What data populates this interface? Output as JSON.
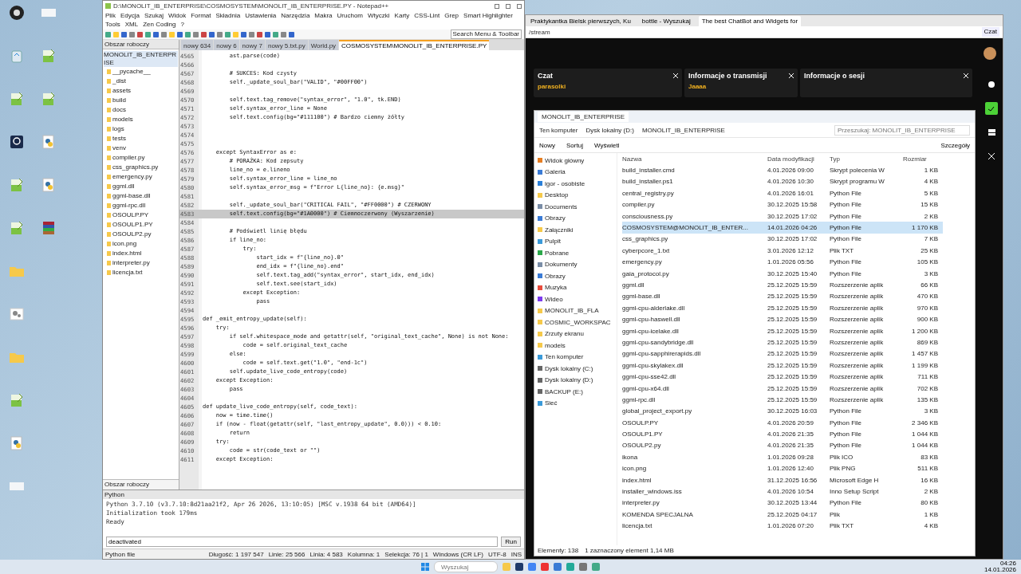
{
  "desktop": {
    "columns": [
      [
        {
          "kind": "obs"
        },
        {
          "kind": "recycle"
        },
        {
          "kind": "notepad"
        },
        {
          "kind": "camera"
        },
        {
          "kind": "notepad"
        },
        {
          "kind": "notepad"
        },
        {
          "kind": "folder"
        },
        {
          "kind": "settings"
        },
        {
          "kind": "folder"
        },
        {
          "kind": "notepad"
        },
        {
          "kind": "python"
        },
        {
          "kind": "blank"
        }
      ],
      [
        {
          "kind": "blank"
        },
        {
          "kind": "notepad"
        },
        {
          "kind": "notepad"
        },
        {
          "kind": "python"
        },
        {
          "kind": "python"
        },
        {
          "kind": "archive"
        }
      ]
    ]
  },
  "editor": {
    "title": "D:\\MONOLIT_IB_ENTERPRISE\\COSMOSYSTEM\\MONOLIT_IB_ENTERPRISE.PY - Notepad++",
    "menu": [
      "Plik",
      "Edycja",
      "Szukaj",
      "Widok",
      "Format",
      "Składnia",
      "Ustawienia",
      "Narzędzia",
      "Makra",
      "Uruchom",
      "Wtyczki",
      "Karty",
      "CSS-Lint",
      "Grep",
      "Smart Highlighter",
      "Tools",
      "XML",
      "Zen Coding",
      "?"
    ],
    "search_menu": "Search Menu & Toolbar",
    "tabs": [
      {
        "label": "nowy 634",
        "selected": false
      },
      {
        "label": "nowy 6",
        "selected": false
      },
      {
        "label": "nowy 7",
        "selected": false
      },
      {
        "label": "nowy 5.txt.py",
        "selected": false
      },
      {
        "label": "World.py",
        "selected": false
      },
      {
        "label": "COSMOSYSTEM\\MONOLIT_IB_ENTERPRISE.PY",
        "selected": true
      }
    ],
    "workspace": {
      "title": "Obszar roboczy",
      "root": "MONOLIT_IB_ENTERPRISE",
      "items": [
        "__pycache__",
        "_dist",
        "assets",
        "build",
        "docs",
        "models",
        "logs",
        "tests",
        "venv",
        "compiler.py",
        "css_graphics.py",
        "emergency.py",
        "ggml.dll",
        "ggml-base.dll",
        "ggml-rpc.dll",
        "OSOULP.PY",
        "OSOULP1.PY",
        "OSOULP2.py",
        "icon.png",
        "index.html",
        "interpreter.py",
        "licencja.txt"
      ],
      "footer": "Obszar roboczy"
    },
    "lines": [
      {
        "number": "4565",
        "code": "        ast.parse(code)"
      },
      {
        "number": "4566"
      },
      {
        "number": "4567",
        "code": "        # SUKCES: Kod czysty"
      },
      {
        "number": "4568",
        "code": "        self._update_soul_bar(\"VALID\", \"#00FF00\")"
      },
      {
        "number": "4569"
      },
      {
        "number": "4570",
        "code": "        self.text.tag_remove(\"syntax_error\", \"1.0\", tk.END)"
      },
      {
        "number": "4571",
        "code": "        self.syntax_error_line = None"
      },
      {
        "number": "4572",
        "code": "        self.text.config(bg=\"#111100\") # Bardzo ciemny żółty"
      },
      {
        "number": "4573"
      },
      {
        "number": "4574"
      },
      {
        "number": "4575"
      },
      {
        "number": "4576",
        "code": "    except SyntaxError as e:"
      },
      {
        "number": "4577",
        "code": "        # PORAŻKA: Kod zepsuty"
      },
      {
        "number": "4578",
        "code": "        line_no = e.lineno"
      },
      {
        "number": "4579",
        "code": "        self.syntax_error_line = line_no"
      },
      {
        "number": "4580",
        "code": "        self.syntax_error_msg = f\"Error L{line_no}: {e.msg}\""
      },
      {
        "number": "4581"
      },
      {
        "number": "4582",
        "code": "        self._update_soul_bar(\"CRITICAL FAIL\", \"#FF0000\") # CZERWONY"
      },
      {
        "number": "4583",
        "code": "        self.text.config(bg=\"#1A0000\") # Ciemnoczerwony (Wyszarzenie)",
        "current": true
      },
      {
        "number": "4584"
      },
      {
        "number": "4585",
        "code": "        # Podświetl linię błędu"
      },
      {
        "number": "4586",
        "code": "        if line_no:"
      },
      {
        "number": "4587",
        "code": "            try:"
      },
      {
        "number": "4588",
        "code": "                start_idx = f\"{line_no}.0\""
      },
      {
        "number": "4589",
        "code": "                end_idx = f\"{line_no}.end\""
      },
      {
        "number": "4590",
        "code": "                self.text.tag_add(\"syntax_error\", start_idx, end_idx)"
      },
      {
        "number": "4591",
        "code": "                self.text.see(start_idx)"
      },
      {
        "number": "4592",
        "code": "            except Exception:"
      },
      {
        "number": "4593",
        "code": "                pass"
      },
      {
        "number": "4594"
      },
      {
        "number": "4595",
        "code": "def _emit_entropy_update(self):"
      },
      {
        "number": "4596",
        "code": "    try:"
      },
      {
        "number": "4597",
        "code": "        if self.whitespace_mode and getattr(self, \"original_text_cache\", None) is not None:"
      },
      {
        "number": "4598",
        "code": "            code = self.original_text_cache"
      },
      {
        "number": "4599",
        "code": "        else:"
      },
      {
        "number": "4600",
        "code": "            code = self.text.get(\"1.0\", \"end-1c\")"
      },
      {
        "number": "4601",
        "code": "        self.update_live_code_entropy(code)"
      },
      {
        "number": "4602",
        "code": "    except Exception:"
      },
      {
        "number": "4603",
        "code": "        pass"
      },
      {
        "number": "4604"
      },
      {
        "number": "4605",
        "code": "def update_live_code_entropy(self, code_text):"
      },
      {
        "number": "4606",
        "code": "    now = time.time()"
      },
      {
        "number": "4607",
        "code": "    if (now - float(getattr(self, \"last_entropy_update\", 0.0))) < 0.10:"
      },
      {
        "number": "4608",
        "code": "        return"
      },
      {
        "number": "4609",
        "code": "    try:"
      },
      {
        "number": "4610",
        "code": "        code = str(code_text or \"\")"
      },
      {
        "number": "4611",
        "code": "    except Exception:"
      }
    ],
    "console": {
      "title": "Python",
      "lines": [
        "Python 3.7.10 (v3.7.10:8d21aa21f2, Apr 26 2026, 13:10:05) [MSC v.1938 64 bit (AMD64)]",
        "Initialization took 179ms",
        "Ready"
      ],
      "input": "deactivated",
      "run": "Run"
    },
    "status": [
      "Python file",
      "Długość: 1 197 547",
      "Linie: 25 566",
      "Linia: 4 583",
      "Kolumna: 1",
      "Selekcja: 76 | 1",
      "Windows (CR LF)",
      "UTF-8",
      "INS"
    ]
  },
  "browser": {
    "tabs": [
      {
        "label": "Praktykantka Bielsk pierwszych, Ku",
        "selected": false
      },
      {
        "label": "bottle - Wyszukaj",
        "selected": false
      },
      {
        "label": "The best ChatBot and Widgets for",
        "selected": true
      }
    ],
    "address": "/stream",
    "copilot": "Czat",
    "panels": [
      {
        "kind": "chat",
        "title": "Czat",
        "text": "parasolki"
      },
      {
        "kind": "info",
        "title": "Informacje o transmisji",
        "text": "Jaaaa"
      },
      {
        "kind": "session",
        "title": "Informacje o sesji"
      }
    ]
  },
  "explorer": {
    "tab": "MONOLIT_IB_ENTERPRISE",
    "breadcrumb": [
      "Ten komputer",
      "Dysk lokalny (D:)",
      "MONOLIT_IB_ENTERPRISE"
    ],
    "search": {
      "placeholder": "Przeszukaj: MONOLIT_IB_ENTERPRISE"
    },
    "toolbar": {
      "new": "Nowy",
      "sort": "Sortuj",
      "view": "Wyświetl",
      "details": "Szczegóły"
    },
    "nav": [
      {
        "label": "Widok główny",
        "kind": "home"
      },
      {
        "label": "Galeria",
        "kind": "gallery"
      },
      {
        "label": "igor - osobiste",
        "kind": "cloud"
      },
      {
        "label": "Desktop",
        "kind": "folder"
      },
      {
        "label": "Documents",
        "kind": "doc"
      },
      {
        "label": "Obrazy",
        "kind": "pictures"
      },
      {
        "label": "Załączniki",
        "kind": "folder"
      },
      {
        "label": "Pulpit",
        "kind": "desktop"
      },
      {
        "label": "Pobrane",
        "kind": "download"
      },
      {
        "label": "Dokumenty",
        "kind": "doc"
      },
      {
        "label": "Obrazy",
        "kind": "pictures"
      },
      {
        "label": "Muzyka",
        "kind": "music"
      },
      {
        "label": "Wideo",
        "kind": "video"
      },
      {
        "label": "MONOLIT_IB_FLA",
        "kind": "folder"
      },
      {
        "label": "COSMIC_WORKSPAC",
        "kind": "folder"
      },
      {
        "label": "Zrzuty ekranu",
        "kind": "folder"
      },
      {
        "label": "models",
        "kind": "folder"
      },
      {
        "label": "Ten komputer",
        "kind": "pc"
      },
      {
        "label": "Dysk lokalny (C:)",
        "kind": "drive"
      },
      {
        "label": "Dysk lokalny (D:)",
        "kind": "drive"
      },
      {
        "label": "BACKUP (E:)",
        "kind": "drive"
      },
      {
        "label": "Sieć",
        "kind": "network"
      }
    ],
    "columns": [
      "Nazwa",
      "Data modyfikacji",
      "Typ",
      "Rozmiar"
    ],
    "files": [
      {
        "name": "build_installer.cmd",
        "date": "4.01.2026 09:00",
        "type": "Skrypt polecenia W",
        "size": "1 KB",
        "selected": false
      },
      {
        "name": "build_installer.ps1",
        "date": "4.01.2026 10:30",
        "type": "Skrypt programu W",
        "size": "4 KB",
        "selected": false
      },
      {
        "name": "central_registry.py",
        "date": "4.01.2026 16:01",
        "type": "Python File",
        "size": "5 KB",
        "selected": false
      },
      {
        "name": "compiler.py",
        "date": "30.12.2025 15:58",
        "type": "Python File",
        "size": "15 KB",
        "selected": false
      },
      {
        "name": "consciousness.py",
        "date": "30.12.2025 17:02",
        "type": "Python File",
        "size": "2 KB",
        "selected": false
      },
      {
        "name": "COSMOSYSTEM@MONOLIT_IB_ENTER...",
        "date": "14.01.2026 04:26",
        "type": "Python File",
        "size": "1 170 KB",
        "selected": true
      },
      {
        "name": "css_graphics.py",
        "date": "30.12.2025 17:02",
        "type": "Python File",
        "size": "7 KB",
        "selected": false
      },
      {
        "name": "cyberpcore_1.txt",
        "date": "3.01.2026 12:12",
        "type": "Plik TXT",
        "size": "25 KB",
        "selected": false
      },
      {
        "name": "emergency.py",
        "date": "1.01.2026 05:56",
        "type": "Python File",
        "size": "105 KB",
        "selected": false
      },
      {
        "name": "gaia_protocol.py",
        "date": "30.12.2025 15:40",
        "type": "Python File",
        "size": "3 KB",
        "selected": false
      },
      {
        "name": "ggml.dll",
        "date": "25.12.2025 15:59",
        "type": "Rozszerzenie aplik",
        "size": "66 KB",
        "selected": false
      },
      {
        "name": "ggml-base.dll",
        "date": "25.12.2025 15:59",
        "type": "Rozszerzenie aplik",
        "size": "470 KB",
        "selected": false
      },
      {
        "name": "ggml-cpu-alderlake.dll",
        "date": "25.12.2025 15:59",
        "type": "Rozszerzenie aplik",
        "size": "970 KB",
        "selected": false
      },
      {
        "name": "ggml-cpu-haswell.dll",
        "date": "25.12.2025 15:59",
        "type": "Rozszerzenie aplik",
        "size": "900 KB",
        "selected": false
      },
      {
        "name": "ggml-cpu-icelake.dll",
        "date": "25.12.2025 15:59",
        "type": "Rozszerzenie aplik",
        "size": "1 200 KB",
        "selected": false
      },
      {
        "name": "ggml-cpu-sandybridge.dll",
        "date": "25.12.2025 15:59",
        "type": "Rozszerzenie aplik",
        "size": "869 KB",
        "selected": false
      },
      {
        "name": "ggml-cpu-sapphirerapids.dll",
        "date": "25.12.2025 15:59",
        "type": "Rozszerzenie aplik",
        "size": "1 457 KB",
        "selected": false
      },
      {
        "name": "ggml-cpu-skylakex.dll",
        "date": "25.12.2025 15:59",
        "type": "Rozszerzenie aplik",
        "size": "1 199 KB",
        "selected": false
      },
      {
        "name": "ggml-cpu-sse42.dll",
        "date": "25.12.2025 15:59",
        "type": "Rozszerzenie aplik",
        "size": "711 KB",
        "selected": false
      },
      {
        "name": "ggml-cpu-x64.dll",
        "date": "25.12.2025 15:59",
        "type": "Rozszerzenie aplik",
        "size": "702 KB",
        "selected": false
      },
      {
        "name": "ggml-rpc.dll",
        "date": "25.12.2025 15:59",
        "type": "Rozszerzenie aplik",
        "size": "135 KB",
        "selected": false
      },
      {
        "name": "global_project_export.py",
        "date": "30.12.2025 16:03",
        "type": "Python File",
        "size": "3 KB",
        "selected": false
      },
      {
        "name": "OSOULP.PY",
        "date": "4.01.2026 20:59",
        "type": "Python File",
        "size": "2 346 KB",
        "selected": false
      },
      {
        "name": "OSOULP1.PY",
        "date": "4.01.2026 21:35",
        "type": "Python File",
        "size": "1 044 KB",
        "selected": false
      },
      {
        "name": "OSOULP2.py",
        "date": "4.01.2026 21:35",
        "type": "Python File",
        "size": "1 044 KB",
        "selected": false
      },
      {
        "name": "ikona",
        "date": "1.01.2026 09:28",
        "type": "Plik ICO",
        "size": "83 KB",
        "selected": false
      },
      {
        "name": "icon.png",
        "date": "1.01.2026 12:40",
        "type": "Plik PNG",
        "size": "511 KB",
        "selected": false
      },
      {
        "name": "index.html",
        "date": "31.12.2025 16:56",
        "type": "Microsoft Edge H",
        "size": "16 KB",
        "selected": false
      },
      {
        "name": "installer_windows.iss",
        "date": "4.01.2026 10:54",
        "type": "Inno Setup Script",
        "size": "2 KB",
        "selected": false
      },
      {
        "name": "interpreter.py",
        "date": "30.12.2025 13:44",
        "type": "Python File",
        "size": "80 KB",
        "selected": false
      },
      {
        "name": "KOMENDA SPECJALNA",
        "date": "25.12.2025 04:17",
        "type": "Plik",
        "size": "1 KB",
        "selected": false
      },
      {
        "name": "licencja.txt",
        "date": "1.01.2026 07:20",
        "type": "Plik TXT",
        "size": "4 KB",
        "selected": false
      }
    ],
    "status": [
      "Elementy: 138",
      "1 zaznaczony element  1,14 MB"
    ]
  },
  "taskbar": {
    "search": {
      "placeholder": "Wyszukaj"
    },
    "time": "04:26",
    "date": "14.01.2026"
  }
}
